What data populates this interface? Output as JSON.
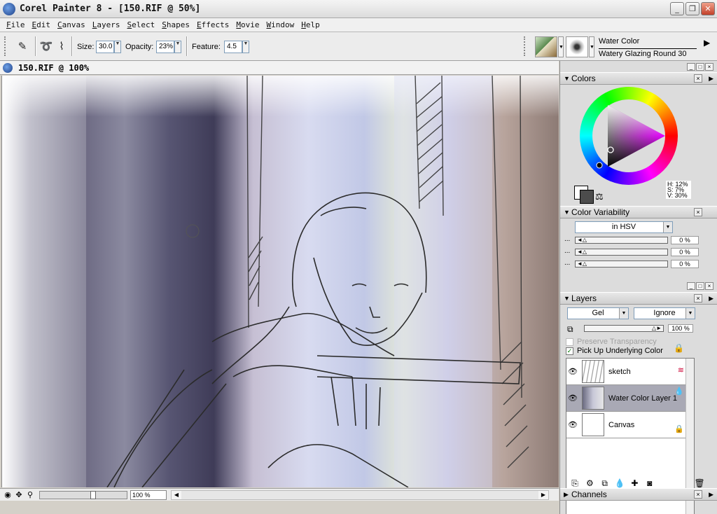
{
  "app": {
    "title": "Corel Painter 8 - [150.RIF @ 50%]",
    "window_buttons": {
      "minimize": "_",
      "maximize": "❐",
      "close": "✕"
    }
  },
  "menu": [
    "File",
    "Edit",
    "Canvas",
    "Layers",
    "Select",
    "Shapes",
    "Effects",
    "Movie",
    "Window",
    "Help"
  ],
  "propbar": {
    "size_label": "Size:",
    "size_value": "30.0",
    "opacity_label": "Opacity:",
    "opacity_value": "23%",
    "feature_label": "Feature:",
    "feature_value": "4.5",
    "brush_category": "Water Color",
    "brush_variant": "Watery Glazing Round 30"
  },
  "document": {
    "title": "150.RIF @ 100%",
    "zoom": "100 %",
    "zoom_level": 0.62
  },
  "colors": {
    "title": "Colors",
    "hue": "H: 12%",
    "sat": "S: 7%",
    "val": "V: 30%",
    "primary": "#4c4c4c",
    "secondary": "#ffffff"
  },
  "color_variability": {
    "title": "Color Variability",
    "mode": "in HSV",
    "rows": [
      {
        "value": "0 %"
      },
      {
        "value": "0 %"
      },
      {
        "value": "0 %"
      }
    ]
  },
  "layers": {
    "title": "Layers",
    "composite_method": "Gel",
    "depth": "Ignore",
    "opacity": "100 %",
    "preserve_transparency": "Preserve Transparency",
    "pick_up_underlying": "Pick Up Underlying Color",
    "items": [
      {
        "name": "sketch",
        "selected": false
      },
      {
        "name": "Water Color Layer 1",
        "selected": true
      },
      {
        "name": "Canvas",
        "selected": false
      }
    ]
  },
  "channels": {
    "title": "Channels"
  }
}
